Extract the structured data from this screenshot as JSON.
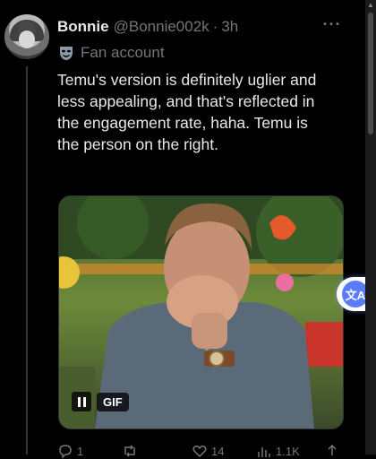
{
  "post": {
    "author_name": "Bonnie",
    "author_handle": "@Bonnie002k",
    "separator": "·",
    "timestamp": "3h",
    "badge_label": "Fan account",
    "text": "Temu's version is definitely uglier and less appealing, and that's reflected in the engagement rate, haha. Temu is the person on the right.",
    "media": {
      "type": "GIF",
      "gif_label": "GIF"
    },
    "actions": {
      "replies": "1",
      "retweets": "",
      "likes": "14",
      "views": "1.1K"
    }
  },
  "translate_button": {
    "label": "文A"
  },
  "icons": {
    "more": "more-horizontal-icon",
    "badge": "theater-mask-icon",
    "pause": "pause-icon",
    "reply": "reply-icon",
    "retweet": "retweet-icon",
    "like": "heart-icon",
    "views": "views-icon",
    "share": "share-icon",
    "translate": "translate-icon"
  },
  "colors": {
    "background": "#000000",
    "text": "#e7e9ea",
    "secondary_text": "#71767b",
    "translate_accent": "#5b7cfa"
  }
}
